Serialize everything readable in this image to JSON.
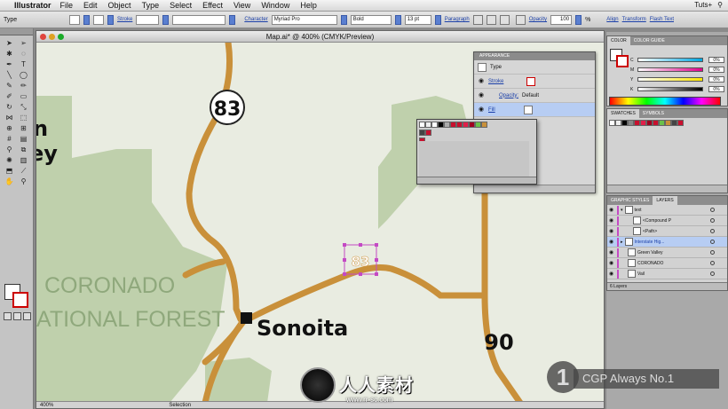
{
  "menubar": {
    "app_name": "Illustrator",
    "items": [
      "File",
      "Edit",
      "Object",
      "Type",
      "Select",
      "Effect",
      "View",
      "Window",
      "Help"
    ],
    "right_label": "Tuts+"
  },
  "control_bar": {
    "selection_type": "Type",
    "stroke_label": "Stroke",
    "character_label": "Character",
    "font_family": "Myriad Pro",
    "font_style": "Bold",
    "font_size": "13 pt",
    "paragraph_label": "Paragraph",
    "opacity_label": "Opacity",
    "opacity_value": "100",
    "opacity_unit": "%",
    "align_label": "Align",
    "transform_label": "Transform",
    "flash_text_label": "Flash Text"
  },
  "document": {
    "title": "Map.ai* @ 400% (CMYK/Preview)",
    "status_zoom": "400%",
    "status_tool": "Selection"
  },
  "map": {
    "region_line1": "CORONADO",
    "region_line2": "ATIONAL FOREST",
    "town": "Sonoita",
    "route_83": "83",
    "route_90": "90",
    "partial_left_1": "n",
    "partial_left_2": "ey",
    "selected_label": "83",
    "colors": {
      "land": "#e9ece1",
      "forest": "#bfd0ac",
      "road": "#c9903a",
      "text": "#111111",
      "forest_text": "#8fa87c"
    }
  },
  "appearance_panel": {
    "tab": "APPEARANCE",
    "type_label": "Type",
    "stroke_label": "Stroke",
    "opacity_label": "Opacity:",
    "opacity_value": "Default",
    "fill_label": "Fill"
  },
  "right_panels": {
    "color_tabs": [
      "COLOR",
      "COLOR GUIDE"
    ],
    "color_channels": [
      {
        "label": "C",
        "value": "0%"
      },
      {
        "label": "M",
        "value": "0%"
      },
      {
        "label": "Y",
        "value": "0%"
      },
      {
        "label": "K",
        "value": "0%"
      }
    ],
    "swatch_tabs": [
      "SWATCHES",
      "SYMBOLS"
    ],
    "layer_tabs": [
      "GRAPHIC STYLES",
      "LAYERS"
    ],
    "layers": [
      {
        "name": "text",
        "selected": false
      },
      {
        "name": "<Compound P",
        "selected": false
      },
      {
        "name": "<Path>",
        "selected": false
      },
      {
        "name": "Interstate Hig...",
        "selected": true
      },
      {
        "name": "Green Valley",
        "selected": false
      },
      {
        "name": "CORONADO",
        "selected": false
      },
      {
        "name": "Vail",
        "selected": false
      }
    ],
    "layers_footer": "6 Layers"
  },
  "watermarks": {
    "badge_number": "1",
    "badge_text": "CGP Always No.1",
    "cn_text": "人人素材",
    "cn_url": "www.rr-sc.com"
  }
}
